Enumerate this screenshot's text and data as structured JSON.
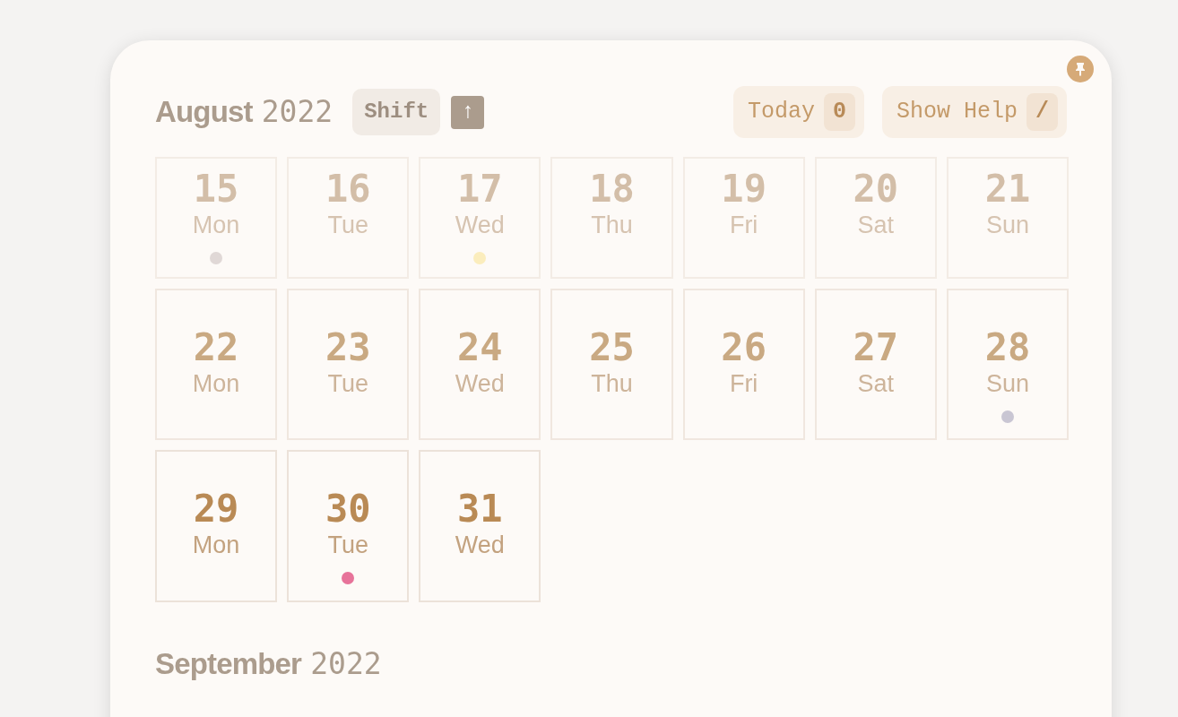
{
  "header": {
    "month": "August",
    "year": "2022",
    "shift_key": "Shift",
    "arrow_key": "↑",
    "buttons": [
      {
        "label": "Today",
        "key": "0"
      },
      {
        "label": "Show Help",
        "key": "/"
      }
    ]
  },
  "weeks": [
    {
      "kind": "faint",
      "days": [
        {
          "number": "15",
          "name": "Mon",
          "color": "#e0d8d6"
        },
        {
          "number": "16",
          "name": "Tue"
        },
        {
          "number": "17",
          "name": "Wed",
          "color": "#fbedbd"
        },
        {
          "number": "18",
          "name": "Thu"
        },
        {
          "number": "19",
          "name": "Fri"
        },
        {
          "number": "20",
          "name": "Sat"
        },
        {
          "number": "21",
          "name": "Sun"
        }
      ]
    },
    {
      "kind": "dim",
      "days": [
        {
          "number": "22",
          "name": "Mon"
        },
        {
          "number": "23",
          "name": "Tue"
        },
        {
          "number": "24",
          "name": "Wed"
        },
        {
          "number": "25",
          "name": "Thu"
        },
        {
          "number": "26",
          "name": "Fri"
        },
        {
          "number": "27",
          "name": "Sat"
        },
        {
          "number": "28",
          "name": "Sun",
          "color": "#c9c6d3"
        }
      ]
    },
    {
      "kind": "normal",
      "days": [
        {
          "number": "29",
          "name": "Mon"
        },
        {
          "number": "30",
          "name": "Tue",
          "color": "#e7739a"
        },
        {
          "number": "31",
          "name": "Wed"
        }
      ]
    }
  ],
  "next_month": {
    "month": "September",
    "year": "2022"
  }
}
